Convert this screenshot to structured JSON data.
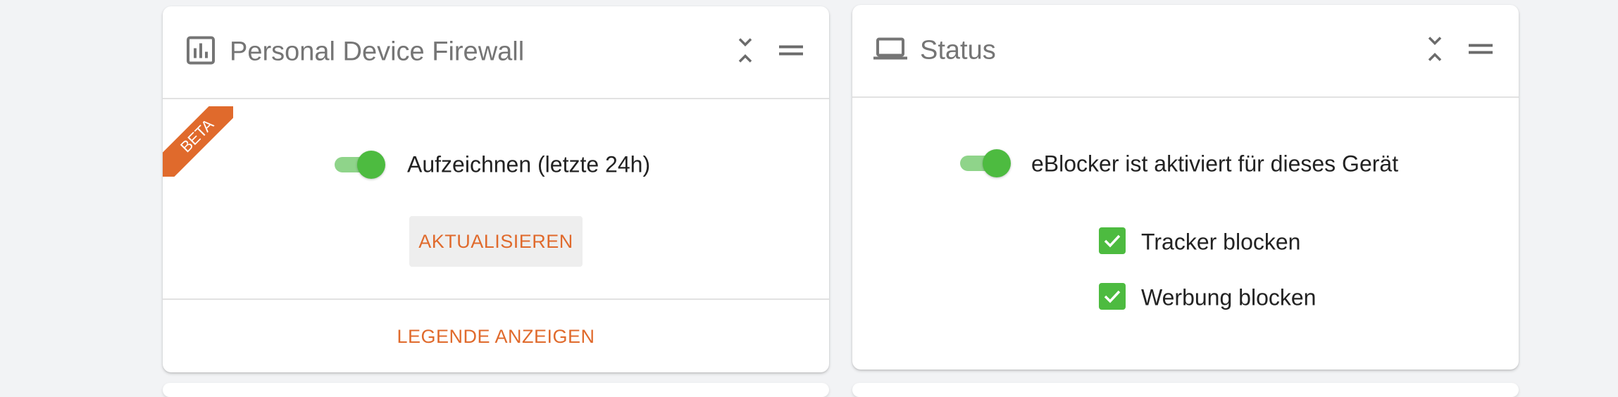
{
  "colors": {
    "accent": "#e06a2c",
    "toggle_on": "#4dbb40",
    "checkbox": "#4dbb40",
    "title_gray": "#757575"
  },
  "firewall_card": {
    "icon": "bar-chart-icon",
    "title": "Personal Device Firewall",
    "ribbon": "BETA",
    "record_toggle": {
      "on": true,
      "label": "Aufzeichnen (letzte 24h)"
    },
    "refresh_label": "AKTUALISIEREN",
    "legend_label": "LEGENDE ANZEIGEN"
  },
  "status_card": {
    "icon": "laptop-icon",
    "title": "Status",
    "active_toggle": {
      "on": true,
      "label": "eBlocker ist aktiviert für dieses Gerät"
    },
    "options": [
      {
        "checked": true,
        "label": "Tracker blocken"
      },
      {
        "checked": true,
        "label": "Werbung blocken"
      }
    ]
  }
}
